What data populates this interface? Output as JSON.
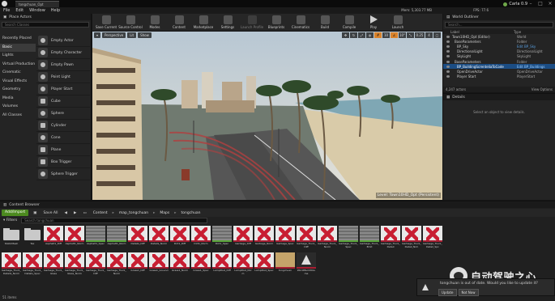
{
  "titlebar": {
    "tab_title": "tongchuan_Opt"
  },
  "menus": [
    "File",
    "Edit",
    "Window",
    "Help"
  ],
  "stats": {
    "fps": "FPS: 77.6",
    "mem": "Mem: 5,303.77 MB"
  },
  "user": {
    "name": "Carla 0.9"
  },
  "place_actors": {
    "title": "Place Actors",
    "search_placeholder": "Search Classes",
    "categories": [
      "Recently Placed",
      "Basic",
      "Lights",
      "Virtual Production",
      "Cinematic",
      "Visual Effects",
      "Geometry",
      "Media",
      "Volumes",
      "All Classes"
    ],
    "active_category": "Basic",
    "actors": [
      "Empty Actor",
      "Empty Character",
      "Empty Pawn",
      "Point Light",
      "Player Start",
      "Cube",
      "Sphere",
      "Cylinder",
      "Cone",
      "Plane",
      "Box Trigger",
      "Sphere Trigger"
    ]
  },
  "toolbar": [
    "Save Current",
    "Source Control",
    "Modes",
    "Content",
    "Marketplace",
    "Settings",
    "Launch Profile",
    "Blueprints",
    "Cinematics",
    "Build",
    "Compile",
    "Play",
    "Launch"
  ],
  "viewport": {
    "buttons": [
      "Perspective",
      "Lit",
      "Show"
    ],
    "right_controls": [
      "10",
      "10°",
      "0.25",
      "4"
    ],
    "level_label": "Level: Town10HD_Opt (Persistent)"
  },
  "outliner": {
    "title": "World Outliner",
    "search_placeholder": "Search...",
    "col_label": "Label",
    "col_type": "Type",
    "rows": [
      {
        "label": "Town10HD_Opt (Editor)",
        "type": "World"
      },
      {
        "label": "BaseParameters",
        "type": "Folder"
      },
      {
        "label": "BP_Sky",
        "type": "Edit BP_Sky"
      },
      {
        "label": "DirectionalLight",
        "type": "DirectionalLight"
      },
      {
        "label": "SkyLight",
        "type": "SkyLight"
      },
      {
        "label": "BaseParameters",
        "type": "Folder"
      },
      {
        "label": "BP_BuildingScrenteliaToCode",
        "type": "Edit BP_Buildings"
      },
      {
        "label": "OpenDriveActor",
        "type": "OpenDriveActor"
      },
      {
        "label": "Player Start",
        "type": "PlayerStart"
      }
    ],
    "actor_count": "4,247 actors",
    "view_options": "View Options"
  },
  "details": {
    "title": "Details",
    "message": "Select an object to view details."
  },
  "content_browser": {
    "title": "Content Browser",
    "add_import": "Add/Import",
    "save_all": "Save All",
    "crumbs": [
      "Content",
      "map_tongchuan",
      "Maps",
      "tongchuan"
    ],
    "filters": "Filters",
    "search_placeholder": "Search tongchuan",
    "status": "51 items",
    "row1": [
      {
        "kind": "folder",
        "label": "StaticMesh"
      },
      {
        "kind": "folder",
        "label": "Tex"
      },
      {
        "kind": "mat",
        "label": "Asphalt1_Diff"
      },
      {
        "kind": "mat",
        "label": "Asphalt1_Norm"
      },
      {
        "kind": "tex",
        "label": "Asphalt1_Spec"
      },
      {
        "kind": "tex",
        "label": "Asphalt1_Norm"
      },
      {
        "kind": "mat",
        "label": "Details_Diff"
      },
      {
        "kind": "mat",
        "label": "Details_Norm"
      },
      {
        "kind": "mat",
        "label": "Dirt1_Diff"
      },
      {
        "kind": "mat",
        "label": "Dirt1_Norm"
      },
      {
        "kind": "tex",
        "label": "Dirt1_Spec"
      },
      {
        "kind": "mat",
        "label": "Garbage_Diff"
      },
      {
        "kind": "mat",
        "label": "Garbage_Norm"
      },
      {
        "kind": "mat",
        "label": "Garbage_Spec"
      },
      {
        "kind": "mat",
        "label": "Garbage_Truck_Diff"
      },
      {
        "kind": "mat",
        "label": "Garbage_Truck_Norm"
      },
      {
        "kind": "tex",
        "label": "Garbage_Truck_Spec"
      },
      {
        "kind": "tex",
        "label": "Garbage_Truck_Emit"
      },
      {
        "kind": "mat",
        "label": "Garbage_Truck_Detail"
      },
      {
        "kind": "mat",
        "label": "Garbage_Truck_Detail_Nrm"
      },
      {
        "kind": "mat",
        "label": "Garbage_Truck_Detail_Spc"
      }
    ],
    "row2": [
      {
        "kind": "mat",
        "label": "Garbage_Truck_Details_Norm"
      },
      {
        "kind": "mat",
        "label": "Garbage_Truck_Details_Spec"
      },
      {
        "kind": "mat",
        "label": "Garbage_Truck_Glass"
      },
      {
        "kind": "mat",
        "label": "Garbage_Truck_Glass_Norm"
      },
      {
        "kind": "mat",
        "label": "Garbage_Truck_Diff"
      },
      {
        "kind": "mat",
        "label": "Garbage_Truck_Norm"
      },
      {
        "kind": "mat",
        "label": "Grass1_Diff"
      },
      {
        "kind": "mat",
        "label": "Grass1_Ground"
      },
      {
        "kind": "mat",
        "label": "Grass1_Norm"
      },
      {
        "kind": "mat",
        "label": "Grass1_Spec"
      },
      {
        "kind": "mat",
        "label": "LampPost_Diff"
      },
      {
        "kind": "mat",
        "label": "LampPost_Norm"
      },
      {
        "kind": "mat",
        "label": "LampPost_Spec"
      },
      {
        "kind": "tong",
        "label": "tongchuan"
      },
      {
        "kind": "dark",
        "label": "WorldBuildVolume"
      }
    ]
  },
  "notification": {
    "message": "tongchuan is out of date. Would you like to update it?",
    "update": "Update",
    "not_now": "Not Now"
  },
  "watermark": {
    "text": "自动驾驶之心"
  },
  "colors": {
    "accent": "#4c8a1f",
    "selection": "#1b4d84",
    "material_bar": "#a71e32",
    "texture_bar": "#5aa53a"
  }
}
